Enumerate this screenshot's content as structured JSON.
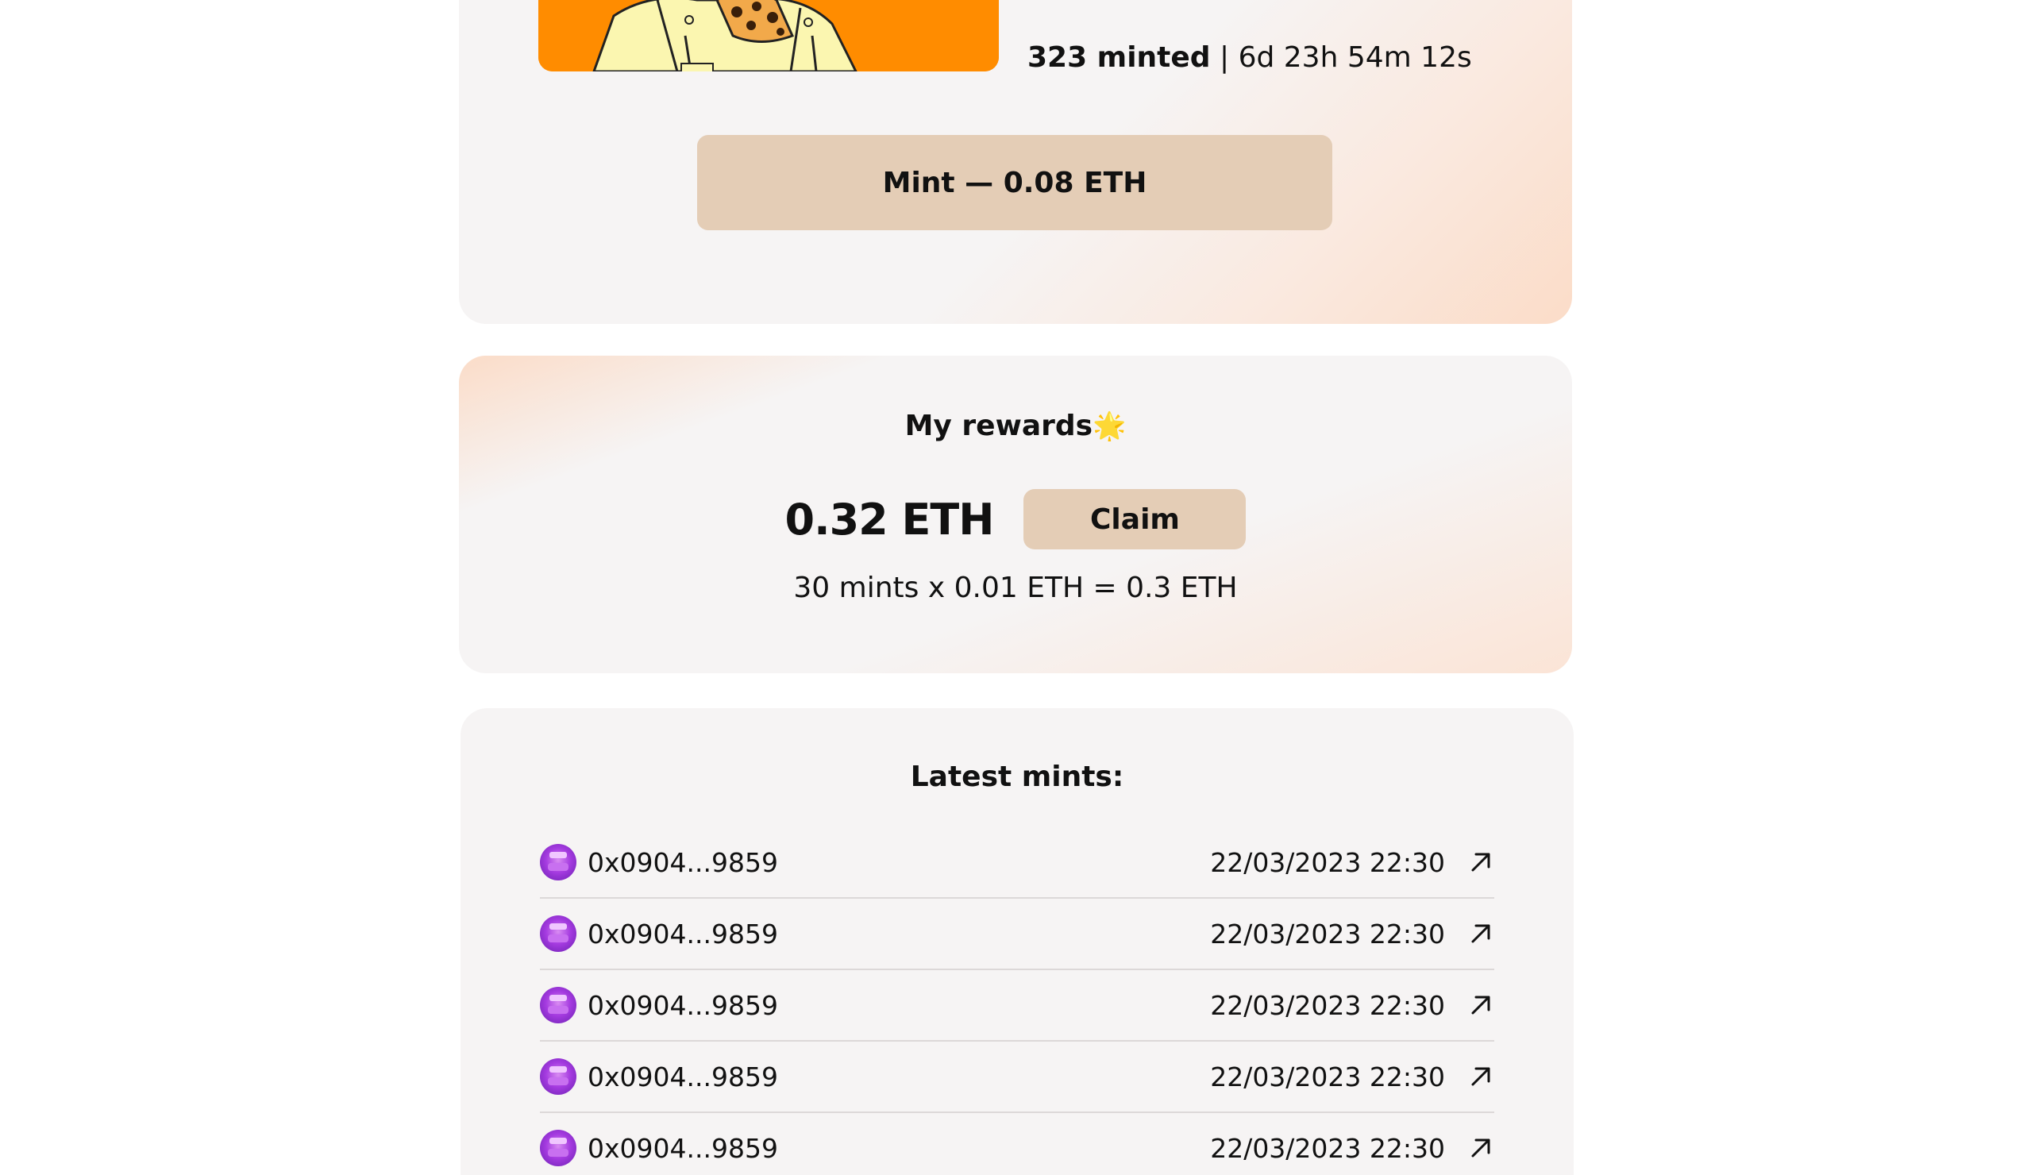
{
  "mint_card": {
    "minted_count": "323 minted",
    "separator": " | ",
    "countdown": "6d 23h 54m 12s",
    "mint_button_label": "Mint — 0.08 ETH"
  },
  "rewards": {
    "title": "My rewards",
    "title_emoji": "🌟",
    "amount": "0.32 ETH",
    "claim_label": "Claim",
    "formula": "30 mints x 0.01 ETH = 0.3 ETH"
  },
  "latest": {
    "title": "Latest mints:",
    "rows": [
      {
        "address": "0x0904...9859",
        "date": "22/03/2023 22:30"
      },
      {
        "address": "0x0904...9859",
        "date": "22/03/2023 22:30"
      },
      {
        "address": "0x0904...9859",
        "date": "22/03/2023 22:30"
      },
      {
        "address": "0x0904...9859",
        "date": "22/03/2023 22:30"
      },
      {
        "address": "0x0904...9859",
        "date": "22/03/2023 22:30"
      }
    ]
  },
  "colors": {
    "nft_background": "#ff8c00",
    "button_background": "#e4cdb6",
    "card_background": "#f6f4f4",
    "avatar_purple": "#a53be0"
  },
  "icons": {
    "row_link": "arrow-up-right-icon",
    "avatar": "wallet-avatar-icon"
  }
}
